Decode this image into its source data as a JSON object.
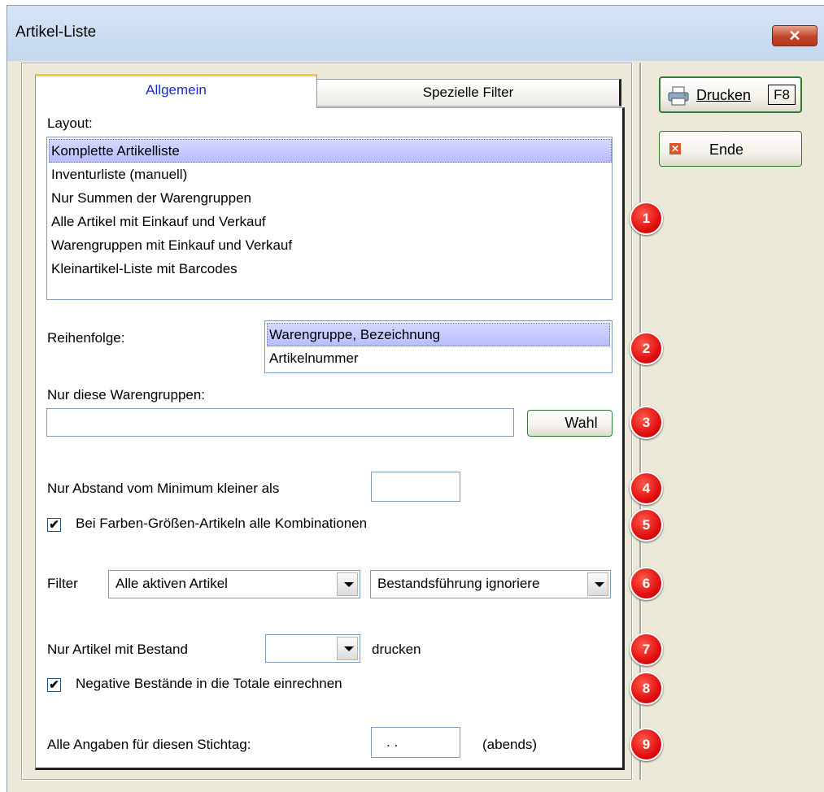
{
  "window": {
    "title": "Artikel-Liste",
    "close_label": "✕"
  },
  "tabs": [
    {
      "label": "Allgemein",
      "active": true
    },
    {
      "label": "Spezielle Filter",
      "active": false
    }
  ],
  "layout": {
    "label": "Layout:",
    "items": [
      "Komplette Artikelliste",
      "Inventurliste (manuell)",
      "Nur Summen der Warengruppen",
      "Alle Artikel mit Einkauf und Verkauf",
      "Warengruppen mit Einkauf und Verkauf",
      "Kleinartikel-Liste mit Barcodes"
    ],
    "selected": "Komplette Artikelliste"
  },
  "order": {
    "label": "Reihenfolge:",
    "items": [
      "Warengruppe, Bezeichnung",
      "Artikelnummer"
    ],
    "selected": "Warengruppe, Bezeichnung"
  },
  "groups": {
    "label": "Nur diese Warengruppen:",
    "value": "",
    "button": "Wahl"
  },
  "distance": {
    "label": "Nur Abstand vom Minimum kleiner als",
    "value": ""
  },
  "combinations": {
    "label": "Bei Farben-Größen-Artikeln alle Kombinationen",
    "checked": true
  },
  "filter": {
    "label": "Filter",
    "value1": "Alle aktiven Artikel",
    "value2": "Bestandsführung ignoriere"
  },
  "stock": {
    "label": "Nur Artikel mit Bestand",
    "value": "",
    "suffix": "drucken"
  },
  "negative": {
    "label": "Negative Bestände in die Totale einrechnen",
    "checked": true
  },
  "date": {
    "label": "Alle Angaben für diesen Stichtag:",
    "value": ". .",
    "suffix": "(abends)"
  },
  "buttons": {
    "print": "Drucken",
    "print_shortcut": "F8",
    "end": "Ende"
  },
  "badges": [
    "1",
    "2",
    "3",
    "4",
    "5",
    "6",
    "7",
    "8",
    "9"
  ],
  "colors": {
    "selection": "#b7bcff",
    "active_tab_text": "#1c2bd6",
    "badge": "#e01010",
    "button_border": "#2f7d32"
  },
  "check_mark": "✔",
  "icons": {
    "print": "printer-icon",
    "end": "close-x-icon"
  }
}
